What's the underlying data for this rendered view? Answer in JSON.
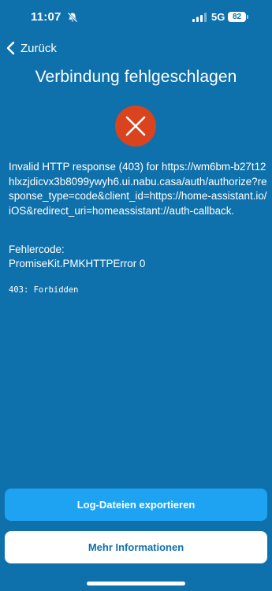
{
  "status_bar": {
    "time": "11:07",
    "network": "5G",
    "battery": "82",
    "icons": [
      "bell-slash-icon",
      "signal-icon",
      "battery-icon"
    ]
  },
  "nav": {
    "back_label": "Zurück",
    "back_icon": "chevron-left-icon"
  },
  "title": "Verbindung fehlgeschlagen",
  "error_icon": "x-circle-icon",
  "message": "Invalid HTTP response (403) for https://wm6bm-b27t12hlxzjdicvx3b8099ywyh6.ui.nabu.casa/auth/authorize?response_type=code&client_id=https://home-assistant.io/iOS&redirect_uri=homeassistant://auth-callback.",
  "error_code": {
    "label": "Fehlercode:",
    "value": "PromiseKit.PMKHTTPError 0"
  },
  "status_detail": "403: Forbidden",
  "buttons": {
    "export_label": "Log-Dateien exportieren",
    "more_label": "Mehr Informationen"
  },
  "colors": {
    "background": "#0f71ab",
    "primary_button": "#1ea3f2",
    "secondary_button": "#ffffff",
    "error_icon": "#d9431e"
  }
}
